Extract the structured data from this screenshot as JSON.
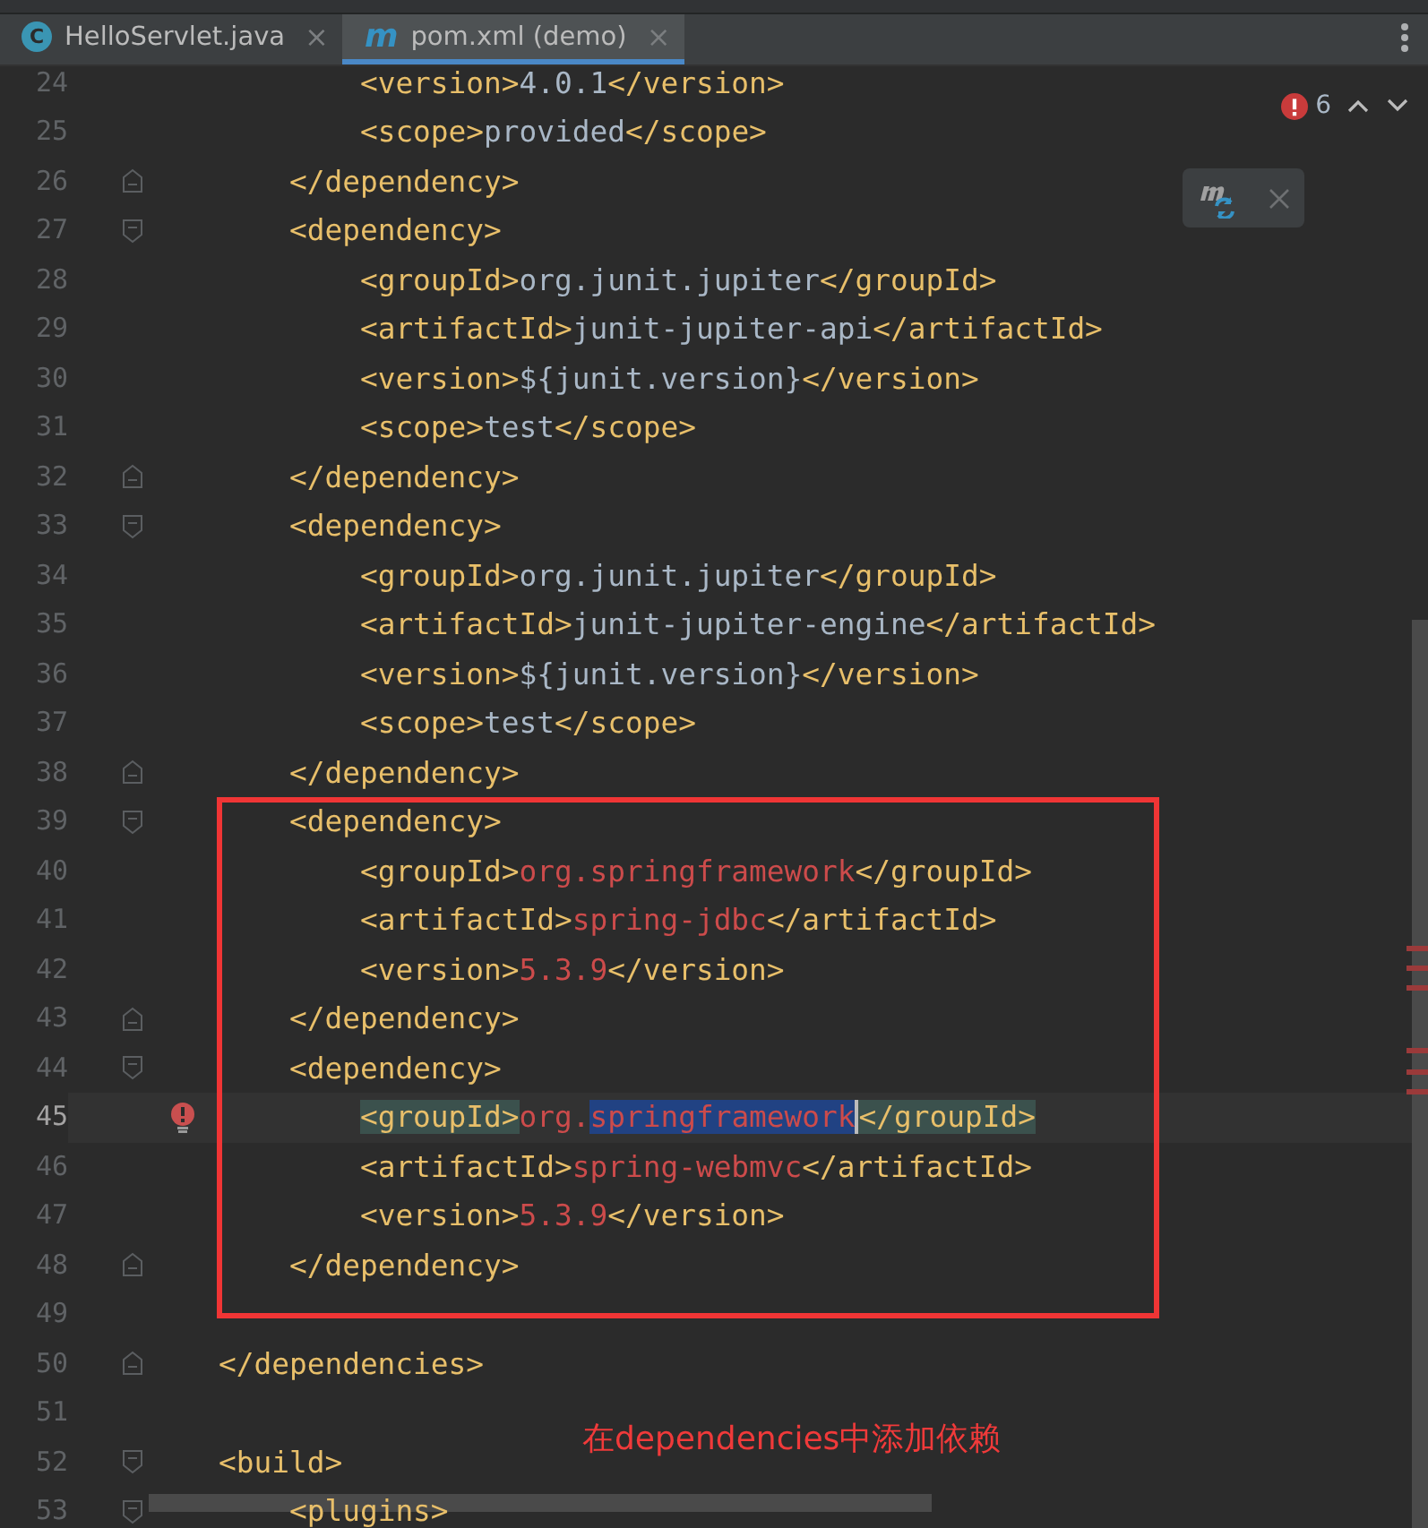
{
  "tabs": [
    {
      "icon": "C",
      "label": "HelloServlet.java",
      "close": "×",
      "selected": false
    },
    {
      "icon": "m",
      "label": "pom.xml (demo)",
      "close": "×",
      "selected": true
    }
  ],
  "inspections": {
    "error_count": "6"
  },
  "lines": [
    {
      "number": "24",
      "kind": "code",
      "segments": [
        {
          "kind": "tag",
          "text": "        <version>"
        },
        {
          "kind": "plain",
          "text": "4.0.1"
        },
        {
          "kind": "tag",
          "text": "</version>"
        }
      ]
    },
    {
      "number": "25",
      "kind": "code",
      "segments": [
        {
          "kind": "tag",
          "text": "        <scope>"
        },
        {
          "kind": "plain",
          "text": "provided"
        },
        {
          "kind": "tag",
          "text": "</scope>"
        }
      ]
    },
    {
      "number": "26",
      "kind": "fold-end",
      "segments": [
        {
          "kind": "tag",
          "text": "    </dependency>"
        }
      ]
    },
    {
      "number": "27",
      "kind": "fold-start",
      "segments": [
        {
          "kind": "tag",
          "text": "    <dependency>"
        }
      ]
    },
    {
      "number": "28",
      "kind": "code",
      "segments": [
        {
          "kind": "tag",
          "text": "        <groupId>"
        },
        {
          "kind": "plain",
          "text": "org.junit.jupiter"
        },
        {
          "kind": "tag",
          "text": "</groupId>"
        }
      ]
    },
    {
      "number": "29",
      "kind": "code",
      "segments": [
        {
          "kind": "tag",
          "text": "        <artifactId>"
        },
        {
          "kind": "plain",
          "text": "junit-jupiter-api"
        },
        {
          "kind": "tag",
          "text": "</artifactId>"
        }
      ]
    },
    {
      "number": "30",
      "kind": "code",
      "segments": [
        {
          "kind": "tag",
          "text": "        <version>"
        },
        {
          "kind": "plain",
          "text": "${junit.version}"
        },
        {
          "kind": "tag",
          "text": "</version>"
        }
      ]
    },
    {
      "number": "31",
      "kind": "code",
      "segments": [
        {
          "kind": "tag",
          "text": "        <scope>"
        },
        {
          "kind": "plain",
          "text": "test"
        },
        {
          "kind": "tag",
          "text": "</scope>"
        }
      ]
    },
    {
      "number": "32",
      "kind": "fold-end",
      "segments": [
        {
          "kind": "tag",
          "text": "    </dependency>"
        }
      ]
    },
    {
      "number": "33",
      "kind": "fold-start",
      "segments": [
        {
          "kind": "tag",
          "text": "    <dependency>"
        }
      ]
    },
    {
      "number": "34",
      "kind": "code",
      "segments": [
        {
          "kind": "tag",
          "text": "        <groupId>"
        },
        {
          "kind": "plain",
          "text": "org.junit.jupiter"
        },
        {
          "kind": "tag",
          "text": "</groupId>"
        }
      ]
    },
    {
      "number": "35",
      "kind": "code",
      "segments": [
        {
          "kind": "tag",
          "text": "        <artifactId>"
        },
        {
          "kind": "plain",
          "text": "junit-jupiter-engine"
        },
        {
          "kind": "tag",
          "text": "</artifactId>"
        }
      ]
    },
    {
      "number": "36",
      "kind": "code",
      "segments": [
        {
          "kind": "tag",
          "text": "        <version>"
        },
        {
          "kind": "plain",
          "text": "${junit.version}"
        },
        {
          "kind": "tag",
          "text": "</version>"
        }
      ]
    },
    {
      "number": "37",
      "kind": "code",
      "segments": [
        {
          "kind": "tag",
          "text": "        <scope>"
        },
        {
          "kind": "plain",
          "text": "test"
        },
        {
          "kind": "tag",
          "text": "</scope>"
        }
      ]
    },
    {
      "number": "38",
      "kind": "fold-end",
      "segments": [
        {
          "kind": "tag",
          "text": "    </dependency>"
        }
      ]
    },
    {
      "number": "39",
      "kind": "fold-start",
      "segments": [
        {
          "kind": "tag",
          "text": "    <dependency>"
        }
      ]
    },
    {
      "number": "40",
      "kind": "code",
      "segments": [
        {
          "kind": "tag",
          "text": "        <groupId>"
        },
        {
          "kind": "error",
          "text": "org.springframework"
        },
        {
          "kind": "tag",
          "text": "</groupId>"
        }
      ]
    },
    {
      "number": "41",
      "kind": "code",
      "segments": [
        {
          "kind": "tag",
          "text": "        <artifactId>"
        },
        {
          "kind": "error",
          "text": "spring-jdbc"
        },
        {
          "kind": "tag",
          "text": "</artifactId>"
        }
      ]
    },
    {
      "number": "42",
      "kind": "code",
      "segments": [
        {
          "kind": "tag",
          "text": "        <version>"
        },
        {
          "kind": "error",
          "text": "5.3.9"
        },
        {
          "kind": "tag",
          "text": "</version>"
        }
      ]
    },
    {
      "number": "43",
      "kind": "fold-end",
      "segments": [
        {
          "kind": "tag",
          "text": "    </dependency>"
        }
      ]
    },
    {
      "number": "44",
      "kind": "fold-start",
      "segments": [
        {
          "kind": "tag",
          "text": "    <dependency>"
        }
      ]
    },
    {
      "number": "45",
      "kind": "code",
      "current": true,
      "error": true,
      "segments": [
        {
          "kind": "matched-tag",
          "text": "        <groupId>"
        },
        {
          "kind": "error",
          "text": "org."
        },
        {
          "kind": "selected-error",
          "text": "springframework"
        },
        {
          "kind": "matched-tag",
          "text": "</groupId>"
        }
      ]
    },
    {
      "number": "46",
      "kind": "code",
      "segments": [
        {
          "kind": "tag",
          "text": "        <artifactId>"
        },
        {
          "kind": "error",
          "text": "spring-webmvc"
        },
        {
          "kind": "tag",
          "text": "</artifactId>"
        }
      ]
    },
    {
      "number": "47",
      "kind": "code",
      "segments": [
        {
          "kind": "tag",
          "text": "        <version>"
        },
        {
          "kind": "error",
          "text": "5.3.9"
        },
        {
          "kind": "tag",
          "text": "</version>"
        }
      ]
    },
    {
      "number": "48",
      "kind": "fold-end",
      "segments": [
        {
          "kind": "tag",
          "text": "    </dependency>"
        }
      ]
    },
    {
      "number": "49",
      "kind": "code"
    },
    {
      "number": "50",
      "kind": "fold-end",
      "segments": [
        {
          "kind": "tag",
          "text": "</dependencies>"
        }
      ]
    },
    {
      "number": "51",
      "kind": "code"
    },
    {
      "number": "52",
      "kind": "fold-start",
      "segments": [
        {
          "kind": "tag",
          "text": "<build>"
        }
      ]
    },
    {
      "number": "53",
      "kind": "fold-start",
      "segments": [
        {
          "kind": "tag",
          "text": "    <plugins>"
        }
      ]
    }
  ],
  "annotation": {
    "text": "在dependencies中添加依赖"
  }
}
